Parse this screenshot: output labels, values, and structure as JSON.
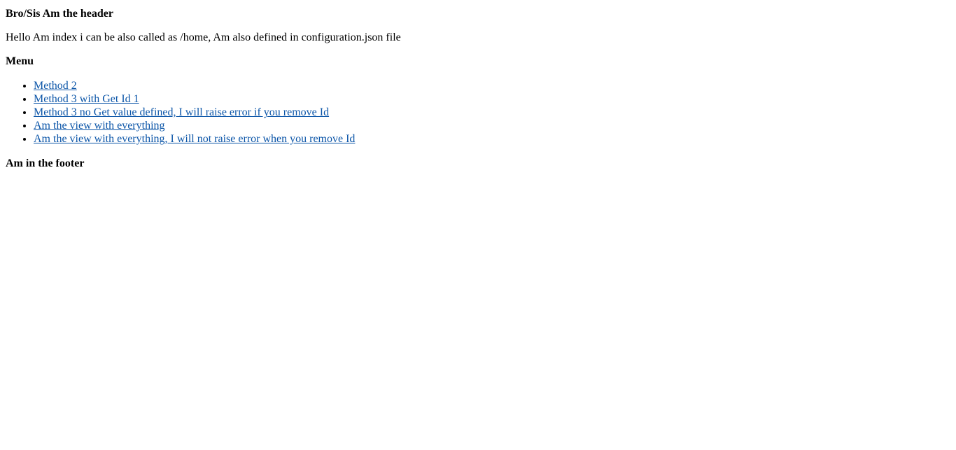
{
  "header": {
    "title": "Bro/Sis Am the header"
  },
  "main": {
    "intro": "Hello Am index i can be also called as /home, Am also defined in configuration.json file",
    "menu_title": "Menu",
    "menu_items": [
      {
        "label": "Method 2"
      },
      {
        "label": "Method 3 with Get Id 1"
      },
      {
        "label": "Method 3 no Get value defined, I will raise error if you remove Id"
      },
      {
        "label": "Am the view with everything"
      },
      {
        "label": "Am the view with everything, I will not raise error when you remove Id"
      }
    ]
  },
  "footer": {
    "text": "Am in the footer"
  },
  "colors": {
    "link": "#0b55a8",
    "text": "#000000",
    "background": "#ffffff"
  }
}
